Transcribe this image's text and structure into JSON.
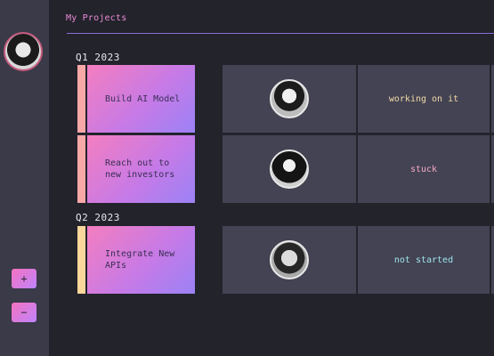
{
  "page_title": "My Projects",
  "sidebar": {
    "add_label": "+",
    "remove_label": "−"
  },
  "groups": [
    {
      "label": "Q1 2023",
      "rows": [
        {
          "name": "Build AI Model",
          "status": "working on it",
          "status_color": "#f3d9a8",
          "stripe_color": "#f9a8a8"
        },
        {
          "name": "Reach out to new investors",
          "status": "stuck",
          "status_color": "#f7a9c6",
          "stripe_color": "#f9a8a8"
        }
      ]
    },
    {
      "label": "Q2 2023",
      "rows": [
        {
          "name": "Integrate New APIs",
          "status": "not started",
          "status_color": "#9fe3ea",
          "stripe_color": "#fcd79b"
        }
      ]
    }
  ]
}
